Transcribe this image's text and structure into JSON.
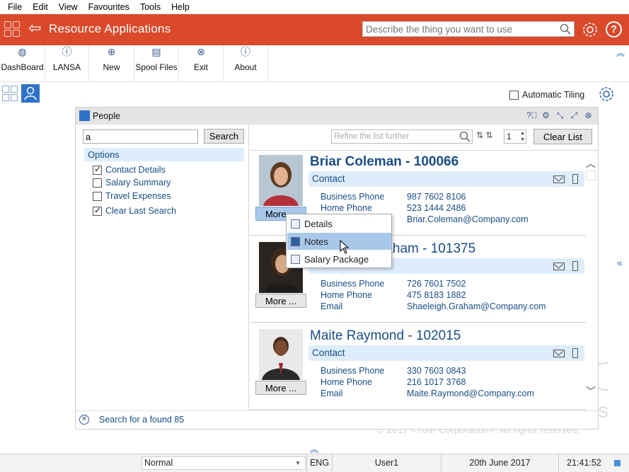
{
  "menu": [
    "File",
    "Edit",
    "View",
    "Favourites",
    "Tools",
    "Help"
  ],
  "header": {
    "title": "Resource Applications",
    "search_placeholder": "Describe the thing you want to use",
    "help_label": "?"
  },
  "toolbar": [
    {
      "label": "DashBoard",
      "icon": "globe-icon"
    },
    {
      "label": "LANSA",
      "icon": "info-circle-icon"
    },
    {
      "label": "New",
      "icon": "plus-circle-icon"
    },
    {
      "label": "Spool Files",
      "icon": "document-icon"
    },
    {
      "label": "Exit",
      "icon": "close-circle-icon"
    },
    {
      "label": "About",
      "icon": "info-circle-icon"
    }
  ],
  "view": {
    "automatic_tiling": "Automatic Tiling"
  },
  "panel": {
    "title": "People",
    "search_value": "a",
    "search_button": "Search",
    "options_title": "Options",
    "options": [
      {
        "label": "Contact Details",
        "checked": true
      },
      {
        "label": "Salary Summary",
        "checked": false
      },
      {
        "label": "Travel Expenses",
        "checked": false
      },
      {
        "label": "Clear Last Search",
        "checked": true
      }
    ],
    "refine_placeholder": "Refine the list further",
    "page": "1",
    "clear_list": "Clear List",
    "status": "Search for a found 85"
  },
  "people": [
    {
      "name": "Briar Coleman - 100066",
      "contact": "Contact",
      "more": "More ...",
      "rows": [
        {
          "k": "Business Phone",
          "v": "987 7602 8106"
        },
        {
          "k": "Home Phone",
          "v": "523 1444 2486"
        },
        {
          "k": "",
          "v": "Briar.Coleman@Company.com"
        }
      ]
    },
    {
      "name": "raham - 101375",
      "contact": "",
      "more": "More ...",
      "rows": [
        {
          "k": "Business Phone",
          "v": "726 7601 7502"
        },
        {
          "k": "Home Phone",
          "v": "475 8183 1882"
        },
        {
          "k": "Email",
          "v": "Shaeleigh.Graham@Company.com"
        }
      ]
    },
    {
      "name": "Maite Raymond - 102015",
      "contact": "Contact",
      "more": "More ...",
      "rows": [
        {
          "k": "Business Phone",
          "v": "330 7603 0843"
        },
        {
          "k": "Home Phone",
          "v": "216 1017 3768"
        },
        {
          "k": "Email",
          "v": "Maite.Raymond@Company.com"
        }
      ]
    }
  ],
  "context_menu": [
    "Details",
    "Notes",
    "Salary Package"
  ],
  "watermark": {
    "copyright": "© 2017 <Your Corporation>. All rights reserved.",
    "letter": "S"
  },
  "statusbar": {
    "mode": "Normal",
    "lang": "ENG",
    "user": "User1",
    "date": "20th June 2017",
    "time": "21:41:52"
  },
  "colors": {
    "brand": "#d9492a",
    "accent": "#1a4d85",
    "highlight": "#a8c8ea"
  }
}
